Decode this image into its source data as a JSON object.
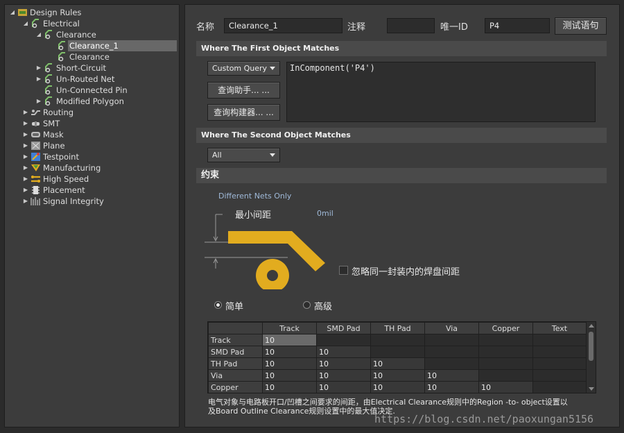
{
  "tree": {
    "root": "Design Rules",
    "electrical": "Electrical",
    "clearance_group": "Clearance",
    "clearance_1": "Clearance_1",
    "clearance": "Clearance",
    "short_circuit": "Short-Circuit",
    "un_routed_net": "Un-Routed Net",
    "un_connected_pin": "Un-Connected Pin",
    "modified_polygon": "Modified Polygon",
    "routing": "Routing",
    "smt": "SMT",
    "mask": "Mask",
    "plane": "Plane",
    "testpoint": "Testpoint",
    "manufacturing": "Manufacturing",
    "high_speed": "High Speed",
    "placement": "Placement",
    "signal_integrity": "Signal Integrity"
  },
  "header": {
    "name_label": "名称",
    "name_value": "Clearance_1",
    "comment_label": "注释",
    "comment_value": "",
    "uid_label": "唯一ID",
    "uid_value": "P4",
    "test_button": "测试语句"
  },
  "first_match": {
    "title": "Where The First Object Matches",
    "combo": "Custom Query",
    "query_helper": "查询助手... ...",
    "query_builder": "查询构建器... ...",
    "query_text": "InComponent('P4')"
  },
  "second_match": {
    "title": "Where The Second Object Matches",
    "combo": "All"
  },
  "constraints": {
    "title": "约束",
    "nets_label": "Different Nets Only",
    "min_clearance_label": "最小间距",
    "min_clearance_value": "0mil",
    "ignore_pads_label": "忽略同一封装内的焊盘间距",
    "mode_simple": "简单",
    "mode_advanced": "高级",
    "simple_selected": true
  },
  "grid": {
    "columns": [
      "Track",
      "SMD Pad",
      "TH Pad",
      "Via",
      "Copper",
      "Text"
    ],
    "rows": [
      {
        "name": "Track",
        "cells": [
          "10",
          "",
          "",
          "",
          "",
          ""
        ]
      },
      {
        "name": "SMD Pad",
        "cells": [
          "10",
          "10",
          "",
          "",
          "",
          ""
        ]
      },
      {
        "name": "TH Pad",
        "cells": [
          "10",
          "10",
          "10",
          "",
          "",
          ""
        ]
      },
      {
        "name": "Via",
        "cells": [
          "10",
          "10",
          "10",
          "10",
          "",
          ""
        ]
      },
      {
        "name": "Copper",
        "cells": [
          "10",
          "10",
          "10",
          "10",
          "10",
          ""
        ]
      }
    ]
  },
  "footer": {
    "desc_line1": "电气对象与电路板开口/凹槽之间要求的间距，由Electrical Clearance规则中的Region -to- object设置以",
    "desc_line2": "及Board Outline Clearance规则设置中的最大值决定.",
    "watermark": "https://blog.csdn.net/paoxungan5156"
  },
  "colors": {
    "rule_icon": "#7fbf6a",
    "copper_yellow": "#e2ac1f",
    "grid_highlight": "#6a6a6a"
  }
}
